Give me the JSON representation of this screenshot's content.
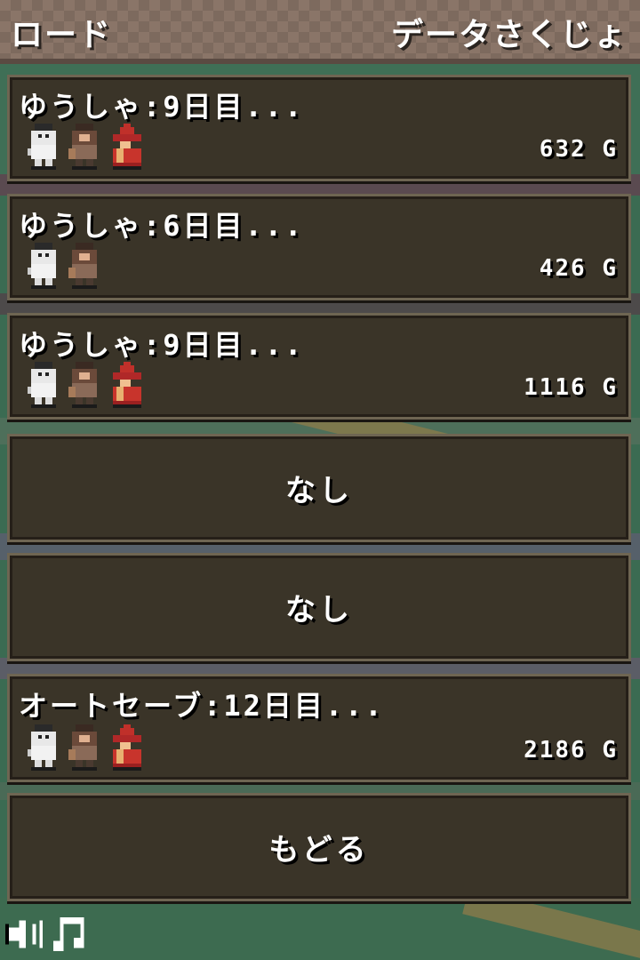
{
  "header": {
    "title": "ロード",
    "delete_label": "データさくじょ"
  },
  "slots": [
    {
      "label": "ゆうしゃ:9日目...",
      "gold": "632 G",
      "party": [
        "knight-sprite",
        "warrior-sprite",
        "mage-sprite"
      ]
    },
    {
      "label": "ゆうしゃ:6日目...",
      "gold": "426 G",
      "party": [
        "knight-sprite",
        "warrior-sprite"
      ]
    },
    {
      "label": "ゆうしゃ:9日目...",
      "gold": "1116 G",
      "party": [
        "knight-sprite",
        "warrior-sprite",
        "mage-sprite"
      ]
    },
    {
      "label": "なし"
    },
    {
      "label": "なし"
    },
    {
      "label": "オートセーブ:12日目...",
      "gold": "2186 G",
      "party": [
        "knight-sprite",
        "warrior-sprite",
        "mage-sprite"
      ]
    }
  ],
  "back_label": "もどる",
  "audio": {
    "sound_icon": "speaker-icon",
    "music_icon": "music-note-icon"
  },
  "colors": {
    "panel": "#3a3428",
    "panel_border": "#6e6552",
    "header": "#8a7568",
    "text": "#ffffff"
  }
}
